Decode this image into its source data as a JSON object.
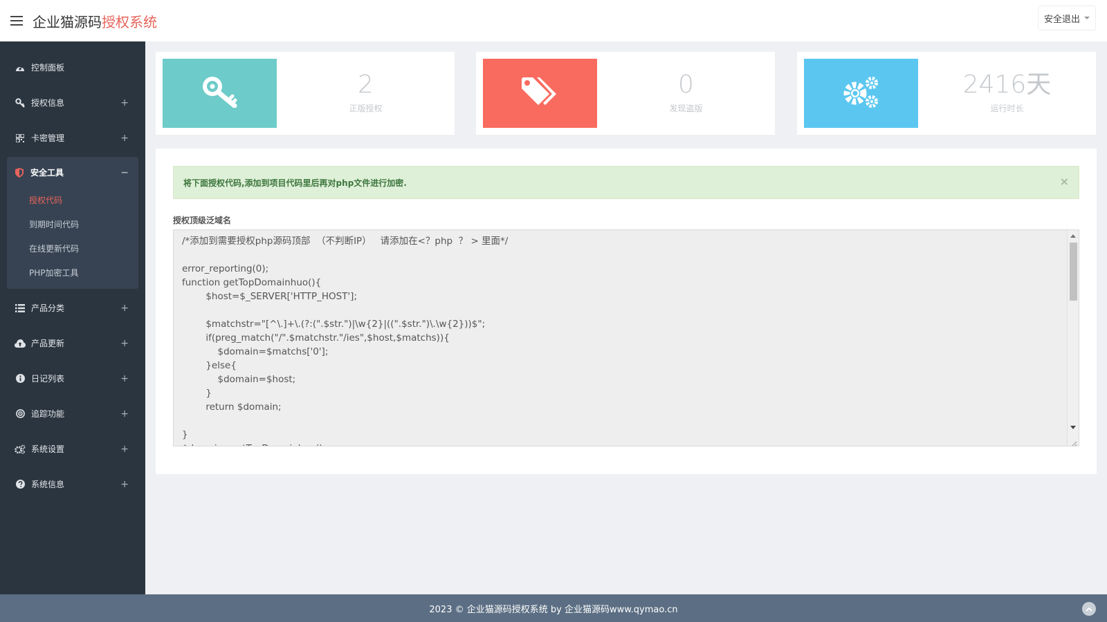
{
  "header": {
    "brand_main": "企业猫源码",
    "brand_accent": "授权系统",
    "logout_label": "安全退出"
  },
  "sidebar": {
    "items_top": [
      {
        "label": "控制面板",
        "icon": "dashboard-icon",
        "has_plus": false
      },
      {
        "label": "授权信息",
        "icon": "key-icon",
        "has_plus": true
      },
      {
        "label": "卡密管理",
        "icon": "grid-icon",
        "has_plus": true
      }
    ],
    "active_group": {
      "label": "安全工具",
      "icon": "shield-icon",
      "toggle": "−",
      "subs": [
        {
          "label": "授权代码",
          "active": true
        },
        {
          "label": "到期时间代码",
          "active": false
        },
        {
          "label": "在线更新代码",
          "active": false
        },
        {
          "label": "PHP加密工具",
          "active": false
        }
      ]
    },
    "items_bottom": [
      {
        "label": "产品分类",
        "icon": "list-icon"
      },
      {
        "label": "产品更新",
        "icon": "cloud-upload-icon"
      },
      {
        "label": "日记列表",
        "icon": "info-icon"
      },
      {
        "label": "追踪功能",
        "icon": "target-icon"
      },
      {
        "label": "系统设置",
        "icon": "gears-icon"
      },
      {
        "label": "系统信息",
        "icon": "question-icon"
      }
    ],
    "plus": "+"
  },
  "stats": [
    {
      "value": "2",
      "label": "正版授权",
      "color": "#6dcbc9",
      "icon": "key-icon"
    },
    {
      "value": "0",
      "label": "发现盗版",
      "color": "#fa6b5f",
      "icon": "tags-icon"
    },
    {
      "value": "2416天",
      "label": "运行时长",
      "color": "#5bc7f0",
      "icon": "gears-icon"
    }
  ],
  "main": {
    "alert_text": "将下面授权代码,添加到项目代码里后再对php文件进行加密.",
    "alert_close": "×",
    "field_label": "授权顶级泛域名",
    "code_lines": [
      "/*添加到需要授权php源码顶部  （不判断IP）   请添加在<？php  ？ > 里面*/",
      "",
      "error_reporting(0);",
      "function getTopDomainhuo(){",
      "\t\t$host=$_SERVER['HTTP_HOST'];",
      "",
      "\t\t$matchstr=\"[^\\.]+\\.(?:(\".$str.\")|\\w{2}|((\".$str.\")\\.\\w{2}))$\";",
      "\t\tif(preg_match(\"/\".$matchstr.\"/ies\",$host,$matchs)){",
      "\t\t\t$domain=$matchs['0'];",
      "\t\t}else{",
      "\t\t\t$domain=$host;",
      "\t\t}",
      "\t\treturn $domain;",
      "",
      "}",
      "$domain=getTopDomainhuo();"
    ]
  },
  "footer": {
    "text": "2023 © 企业猫源码授权系统 by 企业猫源码www.qymao.cn"
  }
}
